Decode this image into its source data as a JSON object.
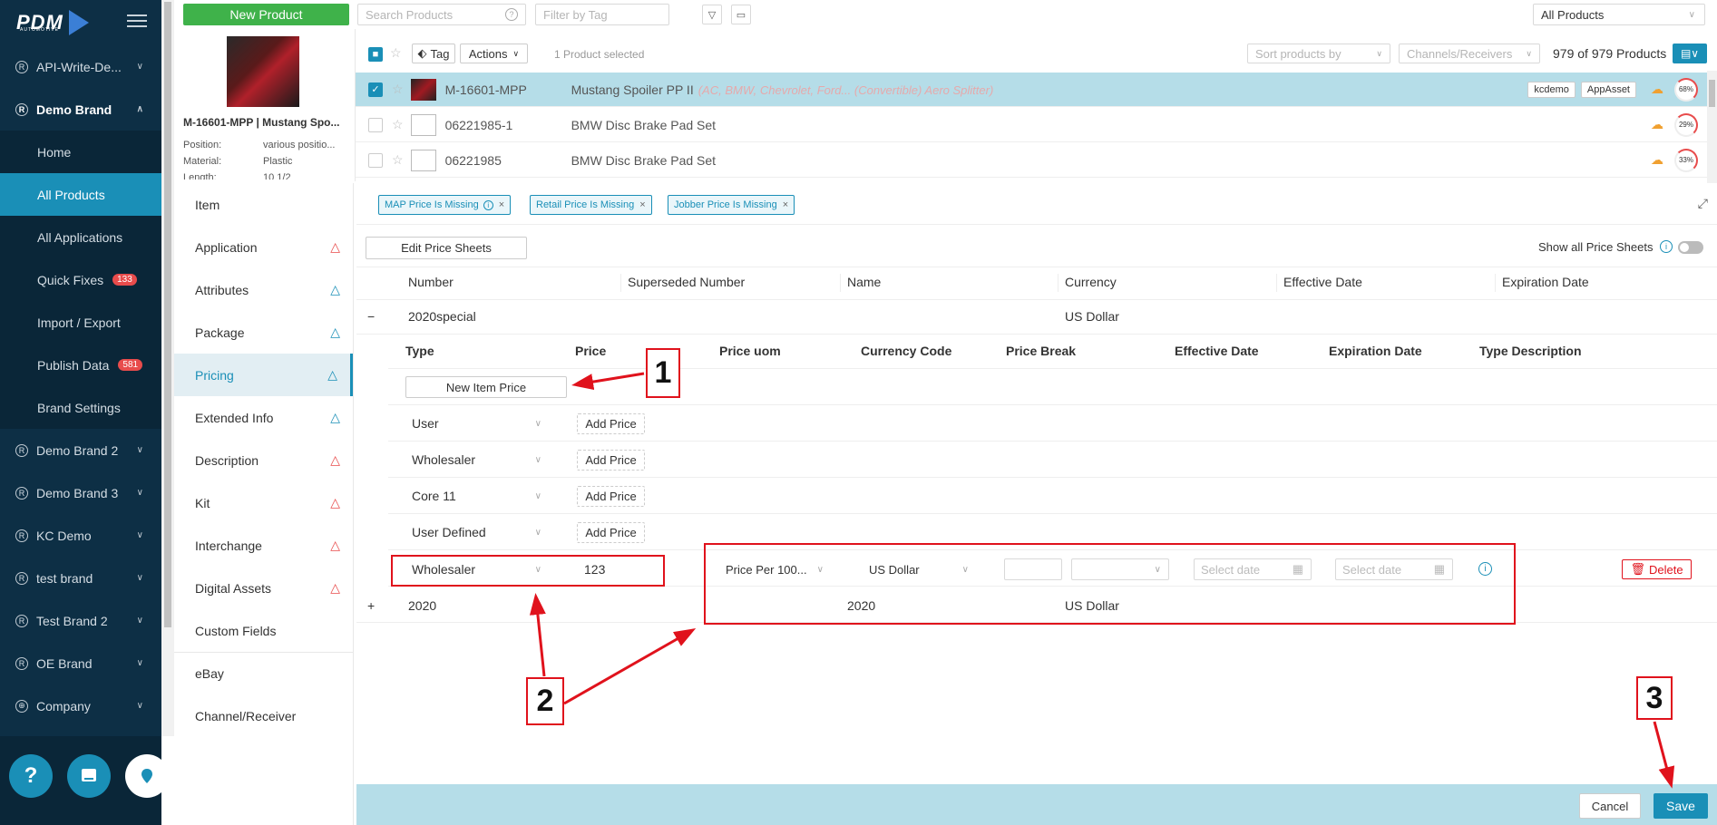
{
  "sidebar": {
    "logo": "PDM",
    "logo_sub": "AUTOMOTIVE",
    "brands_top": [
      {
        "label": "API-Write-De..."
      },
      {
        "label": "Demo Brand"
      }
    ],
    "sub_items": [
      {
        "label": "Home"
      },
      {
        "label": "All Products"
      },
      {
        "label": "All Applications"
      },
      {
        "label": "Quick Fixes",
        "badge": "133"
      },
      {
        "label": "Import / Export"
      },
      {
        "label": "Publish Data",
        "badge": "581"
      },
      {
        "label": "Brand Settings"
      }
    ],
    "brands_bottom": [
      {
        "label": "Demo Brand 2"
      },
      {
        "label": "Demo Brand 3"
      },
      {
        "label": "KC Demo"
      },
      {
        "label": "test brand"
      },
      {
        "label": "Test Brand 2"
      },
      {
        "label": "OE Brand"
      },
      {
        "label": "Company"
      }
    ],
    "help_glyph": "?"
  },
  "toolbar": {
    "new_product": "New Product",
    "search_placeholder": "Search Products",
    "filter_tag_placeholder": "Filter by Tag",
    "scope": "All Products"
  },
  "preview": {
    "name": "M-16601-MPP | Mustang Spo...",
    "rows": [
      {
        "k": "Position:",
        "v": "various positio..."
      },
      {
        "k": "Material:",
        "v": "Plastic"
      },
      {
        "k": "Length:",
        "v": "10 1/2"
      }
    ]
  },
  "list": {
    "tag_label": "Tag",
    "actions_label": "Actions",
    "selected_text": "1 Product selected",
    "sort_placeholder": "Sort products by",
    "channels_placeholder": "Channels/Receivers",
    "count": "979 of 979 Products",
    "rows": [
      {
        "number": "M-16601-MPP",
        "name": "Mustang Spoiler PP II",
        "sub": "(AC, BMW, Chevrolet, Ford... (Convertible) Aero Splitter)",
        "tags": [
          "kcdemo",
          "AppAsset"
        ],
        "score": "68%"
      },
      {
        "number": "06221985-1",
        "name": "BMW Disc Brake Pad Set",
        "sub": "",
        "tags": [],
        "score": "29%"
      },
      {
        "number": "06221985",
        "name": "BMW Disc Brake Pad Set",
        "sub": "",
        "tags": [],
        "score": "33%"
      }
    ]
  },
  "detail_nav": [
    {
      "label": "Item",
      "warn": ""
    },
    {
      "label": "Application",
      "warn": "red"
    },
    {
      "label": "Attributes",
      "warn": "blue"
    },
    {
      "label": "Package",
      "warn": "blue"
    },
    {
      "label": "Pricing",
      "warn": "blue"
    },
    {
      "label": "Extended Info",
      "warn": "blue"
    },
    {
      "label": "Description",
      "warn": "red"
    },
    {
      "label": "Kit",
      "warn": "red"
    },
    {
      "label": "Interchange",
      "warn": "red"
    },
    {
      "label": "Digital Assets",
      "warn": "red"
    },
    {
      "label": "Custom Fields",
      "warn": ""
    },
    {
      "label": "eBay",
      "warn": ""
    },
    {
      "label": "Channel/Receiver",
      "warn": ""
    }
  ],
  "main": {
    "tags": [
      "MAP Price Is Missing",
      "Retail Price Is Missing",
      "Jobber Price Is Missing"
    ],
    "edit_price_sheets": "Edit Price Sheets",
    "show_all_label": "Show all Price Sheets",
    "sheet_headers": [
      "Number",
      "Superseded Number",
      "Name",
      "Currency",
      "Effective Date",
      "Expiration Date"
    ],
    "sheet1": {
      "toggle": "−",
      "number": "2020special",
      "currency": "US Dollar"
    },
    "price_headers": [
      "Type",
      "Price",
      "Price uom",
      "Currency Code",
      "Price Break",
      "Effective Date",
      "Expiration Date",
      "Type Description"
    ],
    "new_item_price": "New Item Price",
    "price_rows": [
      {
        "type": "User",
        "price": "Add Price"
      },
      {
        "type": "Wholesaler",
        "price": "Add Price"
      },
      {
        "type": "Core 11",
        "price": "Add Price"
      },
      {
        "type": "User Defined",
        "price": "Add Price"
      }
    ],
    "edit_row": {
      "type": "Wholesaler",
      "price": "123",
      "uom": "Price Per 100...",
      "currency": "US Dollar",
      "eff_placeholder": "Select date",
      "exp_placeholder": "Select date",
      "delete": "Delete"
    },
    "sheet2": {
      "toggle": "+",
      "number": "2020",
      "name": "2020",
      "currency": "US Dollar"
    },
    "cancel": "Cancel",
    "save": "Save"
  },
  "annotations": [
    "1",
    "2",
    "3"
  ],
  "colors": {
    "accent": "#1a8fb7",
    "sidebar": "#0d2f45",
    "green": "#3fb24a",
    "annotation_red": "#e0121c"
  }
}
